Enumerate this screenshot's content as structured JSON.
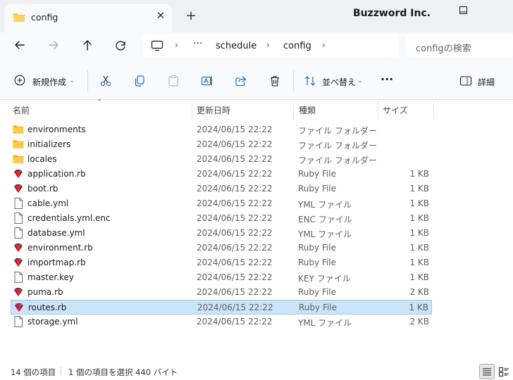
{
  "window": {
    "tab_title": "config",
    "tab_close": "✕",
    "new_tab": "+",
    "brand": "Buzzword Inc."
  },
  "nav": {
    "breadcrumb": [
      "schedule",
      "config"
    ],
    "ellipsis": "···",
    "search_placeholder": "configの検索"
  },
  "toolbar": {
    "new_label": "新規作成",
    "sort_label": "並べ替え",
    "details_label": "詳細",
    "more_label": "···"
  },
  "columns": {
    "name": "名前",
    "date": "更新日時",
    "type": "種類",
    "size": "サイズ"
  },
  "files": [
    {
      "name": "environments",
      "date": "2024/06/15 22:22",
      "type": "ファイル フォルダー",
      "size": "",
      "icon": "folder-icon"
    },
    {
      "name": "initializers",
      "date": "2024/06/15 22:22",
      "type": "ファイル フォルダー",
      "size": "",
      "icon": "folder-icon"
    },
    {
      "name": "locales",
      "date": "2024/06/15 22:22",
      "type": "ファイル フォルダー",
      "size": "",
      "icon": "folder-icon"
    },
    {
      "name": "application.rb",
      "date": "2024/06/15 22:22",
      "type": "Ruby File",
      "size": "1 KB",
      "icon": "ruby-file-icon"
    },
    {
      "name": "boot.rb",
      "date": "2024/06/15 22:22",
      "type": "Ruby File",
      "size": "1 KB",
      "icon": "ruby-file-icon"
    },
    {
      "name": "cable.yml",
      "date": "2024/06/15 22:22",
      "type": "YML ファイル",
      "size": "1 KB",
      "icon": "document-icon"
    },
    {
      "name": "credentials.yml.enc",
      "date": "2024/06/15 22:22",
      "type": "ENC ファイル",
      "size": "1 KB",
      "icon": "document-icon"
    },
    {
      "name": "database.yml",
      "date": "2024/06/15 22:22",
      "type": "YML ファイル",
      "size": "1 KB",
      "icon": "document-icon"
    },
    {
      "name": "environment.rb",
      "date": "2024/06/15 22:22",
      "type": "Ruby File",
      "size": "1 KB",
      "icon": "ruby-file-icon"
    },
    {
      "name": "importmap.rb",
      "date": "2024/06/15 22:22",
      "type": "Ruby File",
      "size": "1 KB",
      "icon": "ruby-file-icon"
    },
    {
      "name": "master.key",
      "date": "2024/06/15 22:22",
      "type": "KEY ファイル",
      "size": "1 KB",
      "icon": "document-icon"
    },
    {
      "name": "puma.rb",
      "date": "2024/06/15 22:22",
      "type": "Ruby File",
      "size": "2 KB",
      "icon": "ruby-file-icon"
    },
    {
      "name": "routes.rb",
      "date": "2024/06/15 22:22",
      "type": "Ruby File",
      "size": "1 KB",
      "icon": "ruby-file-icon",
      "selected": true
    },
    {
      "name": "storage.yml",
      "date": "2024/06/15 22:22",
      "type": "YML ファイル",
      "size": "2 KB",
      "icon": "document-icon"
    }
  ],
  "status": {
    "item_count": "14 個の項目",
    "selection": "1 個の項目を選択  440 バイト"
  },
  "colors": {
    "accent": "#0067c0",
    "selected_bg": "#cce4f7",
    "folder": "#f5c342"
  }
}
